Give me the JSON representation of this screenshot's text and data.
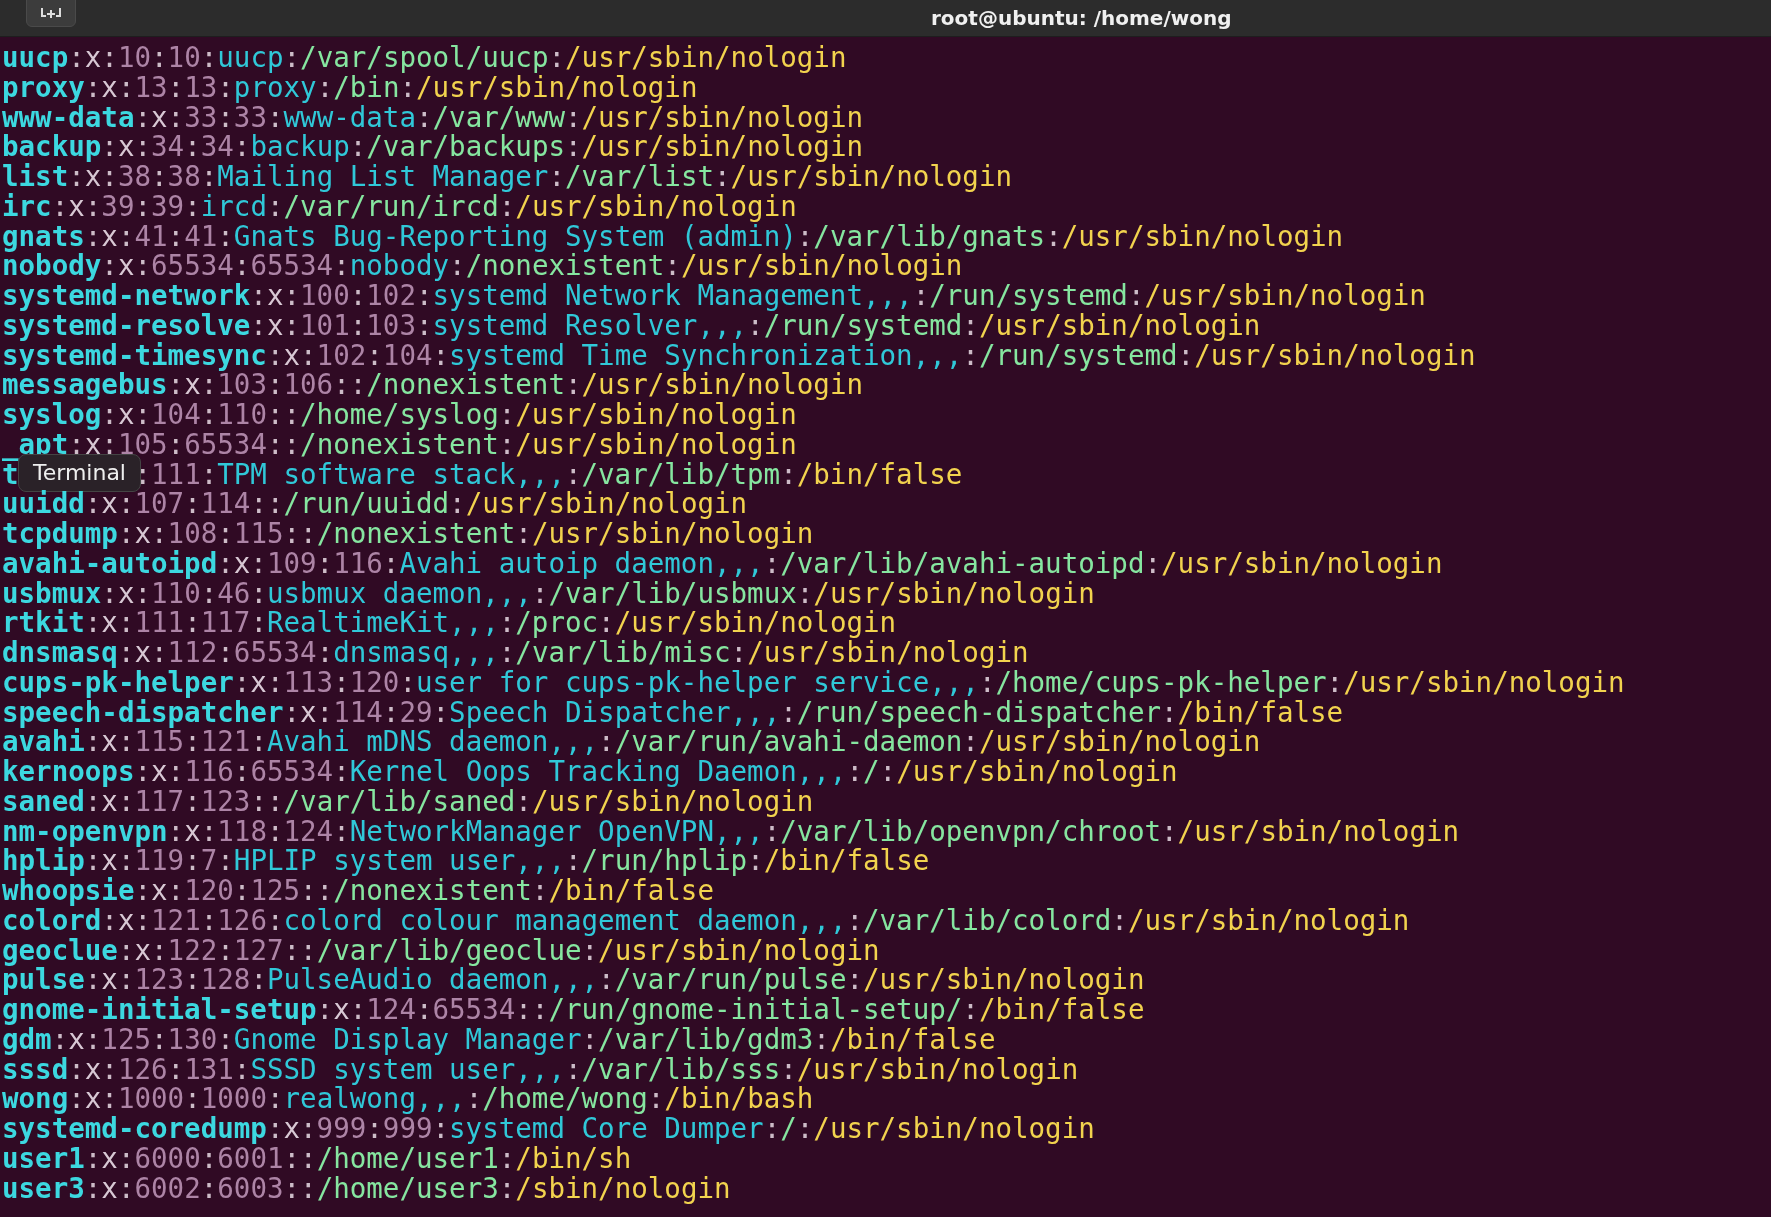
{
  "window": {
    "title": "root@ubuntu: /home/wong"
  },
  "separator": ":",
  "lines": [
    {
      "user": "uucp",
      "password": "x",
      "uid": "10",
      "gid": "10",
      "comment": "uucp",
      "home": "/var/spool/uucp",
      "shell": "/usr/sbin/nologin"
    },
    {
      "user": "proxy",
      "password": "x",
      "uid": "13",
      "gid": "13",
      "comment": "proxy",
      "home": "/bin",
      "shell": "/usr/sbin/nologin"
    },
    {
      "user": "www-data",
      "password": "x",
      "uid": "33",
      "gid": "33",
      "comment": "www-data",
      "home": "/var/www",
      "shell": "/usr/sbin/nologin"
    },
    {
      "user": "backup",
      "password": "x",
      "uid": "34",
      "gid": "34",
      "comment": "backup",
      "home": "/var/backups",
      "shell": "/usr/sbin/nologin"
    },
    {
      "user": "list",
      "password": "x",
      "uid": "38",
      "gid": "38",
      "comment": "Mailing List Manager",
      "home": "/var/list",
      "shell": "/usr/sbin/nologin"
    },
    {
      "user": "irc",
      "password": "x",
      "uid": "39",
      "gid": "39",
      "comment": "ircd",
      "home": "/var/run/ircd",
      "shell": "/usr/sbin/nologin"
    },
    {
      "user": "gnats",
      "password": "x",
      "uid": "41",
      "gid": "41",
      "comment": "Gnats Bug-Reporting System (admin)",
      "home": "/var/lib/gnats",
      "shell": "/usr/sbin/nologin"
    },
    {
      "user": "nobody",
      "password": "x",
      "uid": "65534",
      "gid": "65534",
      "comment": "nobody",
      "home": "/nonexistent",
      "shell": "/usr/sbin/nologin"
    },
    {
      "user": "systemd-network",
      "password": "x",
      "uid": "100",
      "gid": "102",
      "comment": "systemd Network Management,,,",
      "home": "/run/systemd",
      "shell": "/usr/sbin/nologin"
    },
    {
      "user": "systemd-resolve",
      "password": "x",
      "uid": "101",
      "gid": "103",
      "comment": "systemd Resolver,,,",
      "home": "/run/systemd",
      "shell": "/usr/sbin/nologin"
    },
    {
      "user": "systemd-timesync",
      "password": "x",
      "uid": "102",
      "gid": "104",
      "comment": "systemd Time Synchronization,,,",
      "home": "/run/systemd",
      "shell": "/usr/sbin/nologin"
    },
    {
      "user": "messagebus",
      "password": "x",
      "uid": "103",
      "gid": "106",
      "home": "/nonexistent",
      "shell": "/usr/sbin/nologin"
    },
    {
      "user": "syslog",
      "password": "x",
      "uid": "104",
      "gid": "110",
      "home": "/home/syslog",
      "shell": "/usr/sbin/nologin"
    },
    {
      "user": "_apt",
      "password": "x",
      "uid": "105",
      "gid": "65534",
      "home": "/nonexistent",
      "shell": "/usr/sbin/nologin"
    },
    {
      "user": "t",
      "tooltip": "Terminal",
      "gid": "111",
      "comment": "TPM software stack,,,",
      "home": "/var/lib/tpm",
      "shell": "/bin/false"
    },
    {
      "user": "uuidd",
      "password": "x",
      "uid": "107",
      "gid": "114",
      "home": "/run/uuidd",
      "shell": "/usr/sbin/nologin"
    },
    {
      "user": "tcpdump",
      "password": "x",
      "uid": "108",
      "gid": "115",
      "home": "/nonexistent",
      "shell": "/usr/sbin/nologin"
    },
    {
      "user": "avahi-autoipd",
      "password": "x",
      "uid": "109",
      "gid": "116",
      "comment": "Avahi autoip daemon,,,",
      "home": "/var/lib/avahi-autoipd",
      "shell": "/usr/sbin/nologin"
    },
    {
      "user": "usbmux",
      "password": "x",
      "uid": "110",
      "gid": "46",
      "comment": "usbmux daemon,,,",
      "home": "/var/lib/usbmux",
      "shell": "/usr/sbin/nologin"
    },
    {
      "user": "rtkit",
      "password": "x",
      "uid": "111",
      "gid": "117",
      "comment": "RealtimeKit,,,",
      "home": "/proc",
      "shell": "/usr/sbin/nologin"
    },
    {
      "user": "dnsmasq",
      "password": "x",
      "uid": "112",
      "gid": "65534",
      "comment": "dnsmasq,,,",
      "home": "/var/lib/misc",
      "shell": "/usr/sbin/nologin"
    },
    {
      "user": "cups-pk-helper",
      "password": "x",
      "uid": "113",
      "gid": "120",
      "comment": "user for cups-pk-helper service,,,",
      "home": "/home/cups-pk-helper",
      "shell": "/usr/sbin/nologin"
    },
    {
      "user": "speech-dispatcher",
      "password": "x",
      "uid": "114",
      "gid": "29",
      "comment": "Speech Dispatcher,,,",
      "home": "/run/speech-dispatcher",
      "shell": "/bin/false"
    },
    {
      "user": "avahi",
      "password": "x",
      "uid": "115",
      "gid": "121",
      "comment": "Avahi mDNS daemon,,,",
      "home": "/var/run/avahi-daemon",
      "shell": "/usr/sbin/nologin"
    },
    {
      "user": "kernoops",
      "password": "x",
      "uid": "116",
      "gid": "65534",
      "comment": "Kernel Oops Tracking Daemon,,,",
      "home": "/",
      "shell": "/usr/sbin/nologin"
    },
    {
      "user": "saned",
      "password": "x",
      "uid": "117",
      "gid": "123",
      "home": "/var/lib/saned",
      "shell": "/usr/sbin/nologin"
    },
    {
      "user": "nm-openvpn",
      "password": "x",
      "uid": "118",
      "gid": "124",
      "comment": "NetworkManager OpenVPN,,,",
      "home": "/var/lib/openvpn/chroot",
      "shell": "/usr/sbin/nologin"
    },
    {
      "user": "hplip",
      "password": "x",
      "uid": "119",
      "gid": "7",
      "comment": "HPLIP system user,,,",
      "home": "/run/hplip",
      "shell": "/bin/false"
    },
    {
      "user": "whoopsie",
      "password": "x",
      "uid": "120",
      "gid": "125",
      "home": "/nonexistent",
      "shell": "/bin/false"
    },
    {
      "user": "colord",
      "password": "x",
      "uid": "121",
      "gid": "126",
      "comment": "colord colour management daemon,,,",
      "home": "/var/lib/colord",
      "shell": "/usr/sbin/nologin"
    },
    {
      "user": "geoclue",
      "password": "x",
      "uid": "122",
      "gid": "127",
      "home": "/var/lib/geoclue",
      "shell": "/usr/sbin/nologin"
    },
    {
      "user": "pulse",
      "password": "x",
      "uid": "123",
      "gid": "128",
      "comment": "PulseAudio daemon,,,",
      "home": "/var/run/pulse",
      "shell": "/usr/sbin/nologin"
    },
    {
      "user": "gnome-initial-setup",
      "password": "x",
      "uid": "124",
      "gid": "65534",
      "home": "/run/gnome-initial-setup/",
      "shell": "/bin/false"
    },
    {
      "user": "gdm",
      "password": "x",
      "uid": "125",
      "gid": "130",
      "comment": "Gnome Display Manager",
      "home": "/var/lib/gdm3",
      "shell": "/bin/false"
    },
    {
      "user": "sssd",
      "password": "x",
      "uid": "126",
      "gid": "131",
      "comment": "SSSD system user,,,",
      "home": "/var/lib/sss",
      "shell": "/usr/sbin/nologin"
    },
    {
      "user": "wong",
      "password": "x",
      "uid": "1000",
      "gid": "1000",
      "comment": "realwong,,,",
      "home": "/home/wong",
      "shell": "/bin/bash"
    },
    {
      "user": "systemd-coredump",
      "password": "x",
      "uid": "999",
      "gid": "999",
      "comment": "systemd Core Dumper",
      "home": "/",
      "shell": "/usr/sbin/nologin"
    },
    {
      "user": "user1",
      "password": "x",
      "uid": "6000",
      "gid": "6001",
      "home": "/home/user1",
      "shell": "/bin/sh"
    },
    {
      "user": "user3",
      "password": "x",
      "uid": "6002",
      "gid": "6003",
      "home": "/home/user3",
      "shell": "/sbin/nologin"
    }
  ]
}
